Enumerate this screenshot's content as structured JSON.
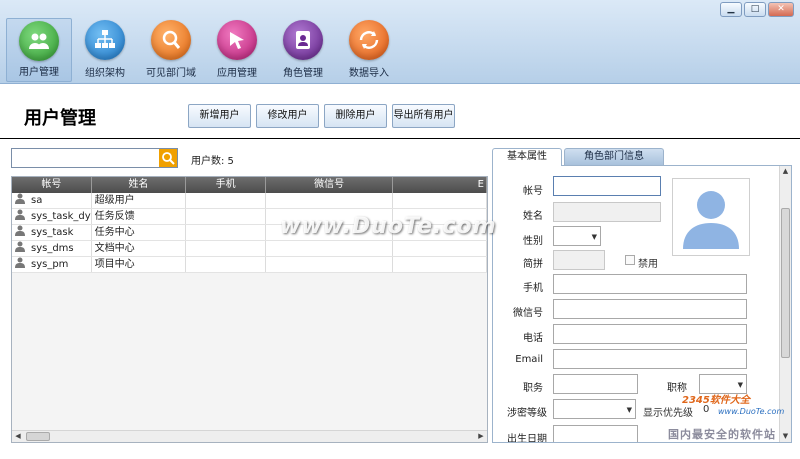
{
  "nav": [
    {
      "label": "用户管理",
      "icon": "users-icon",
      "color": "#3aa83a"
    },
    {
      "label": "组织架构",
      "icon": "org-chart-icon",
      "color": "#1f86d6"
    },
    {
      "label": "可见部门域",
      "icon": "search-icon",
      "color": "#f07a1a"
    },
    {
      "label": "应用管理",
      "icon": "app-icon",
      "color": "#c92b86"
    },
    {
      "label": "角色管理",
      "icon": "contacts-icon",
      "color": "#7a2f9e"
    },
    {
      "label": "数据导入",
      "icon": "sync-icon",
      "color": "#ef6a1d"
    }
  ],
  "page": {
    "title": "用户管理"
  },
  "toolbar": {
    "add_label": "新增用户",
    "edit_label": "修改用户",
    "delete_label": "删除用户",
    "export_label": "导出所有用户"
  },
  "search": {
    "value": "",
    "placeholder": ""
  },
  "user_count": "用户数: 5",
  "grid": {
    "columns": [
      "帐号",
      "姓名",
      "手机",
      "微信号",
      "E"
    ],
    "rows": [
      {
        "account": "sa",
        "name": "超级用户",
        "phone": "",
        "wechat": ""
      },
      {
        "account": "sys_task_dyn",
        "name": "任务反馈",
        "phone": "",
        "wechat": ""
      },
      {
        "account": "sys_task",
        "name": "任务中心",
        "phone": "",
        "wechat": ""
      },
      {
        "account": "sys_dms",
        "name": "文档中心",
        "phone": "",
        "wechat": ""
      },
      {
        "account": "sys_pm",
        "name": "项目中心",
        "phone": "",
        "wechat": ""
      }
    ]
  },
  "tabs": {
    "basic": "基本属性",
    "role_dept": "角色部门信息"
  },
  "form": {
    "account": "帐号",
    "name": "姓名",
    "gender": "性别",
    "pinyin": "简拼",
    "disabled": "禁用",
    "mobile": "手机",
    "wechat": "微信号",
    "phone": "电话",
    "email": "Email",
    "position": "职务",
    "title": "职称",
    "secret_level": "涉密等级",
    "display_priority": "显示优先级",
    "display_priority_value": "0",
    "birthday": "出生日期"
  },
  "watermarks": {
    "main": "www.DuoTe.com",
    "brand": "2345软件大全",
    "brand_url": "www.DuoTe.com",
    "slogan": "国内最安全的软件站"
  }
}
